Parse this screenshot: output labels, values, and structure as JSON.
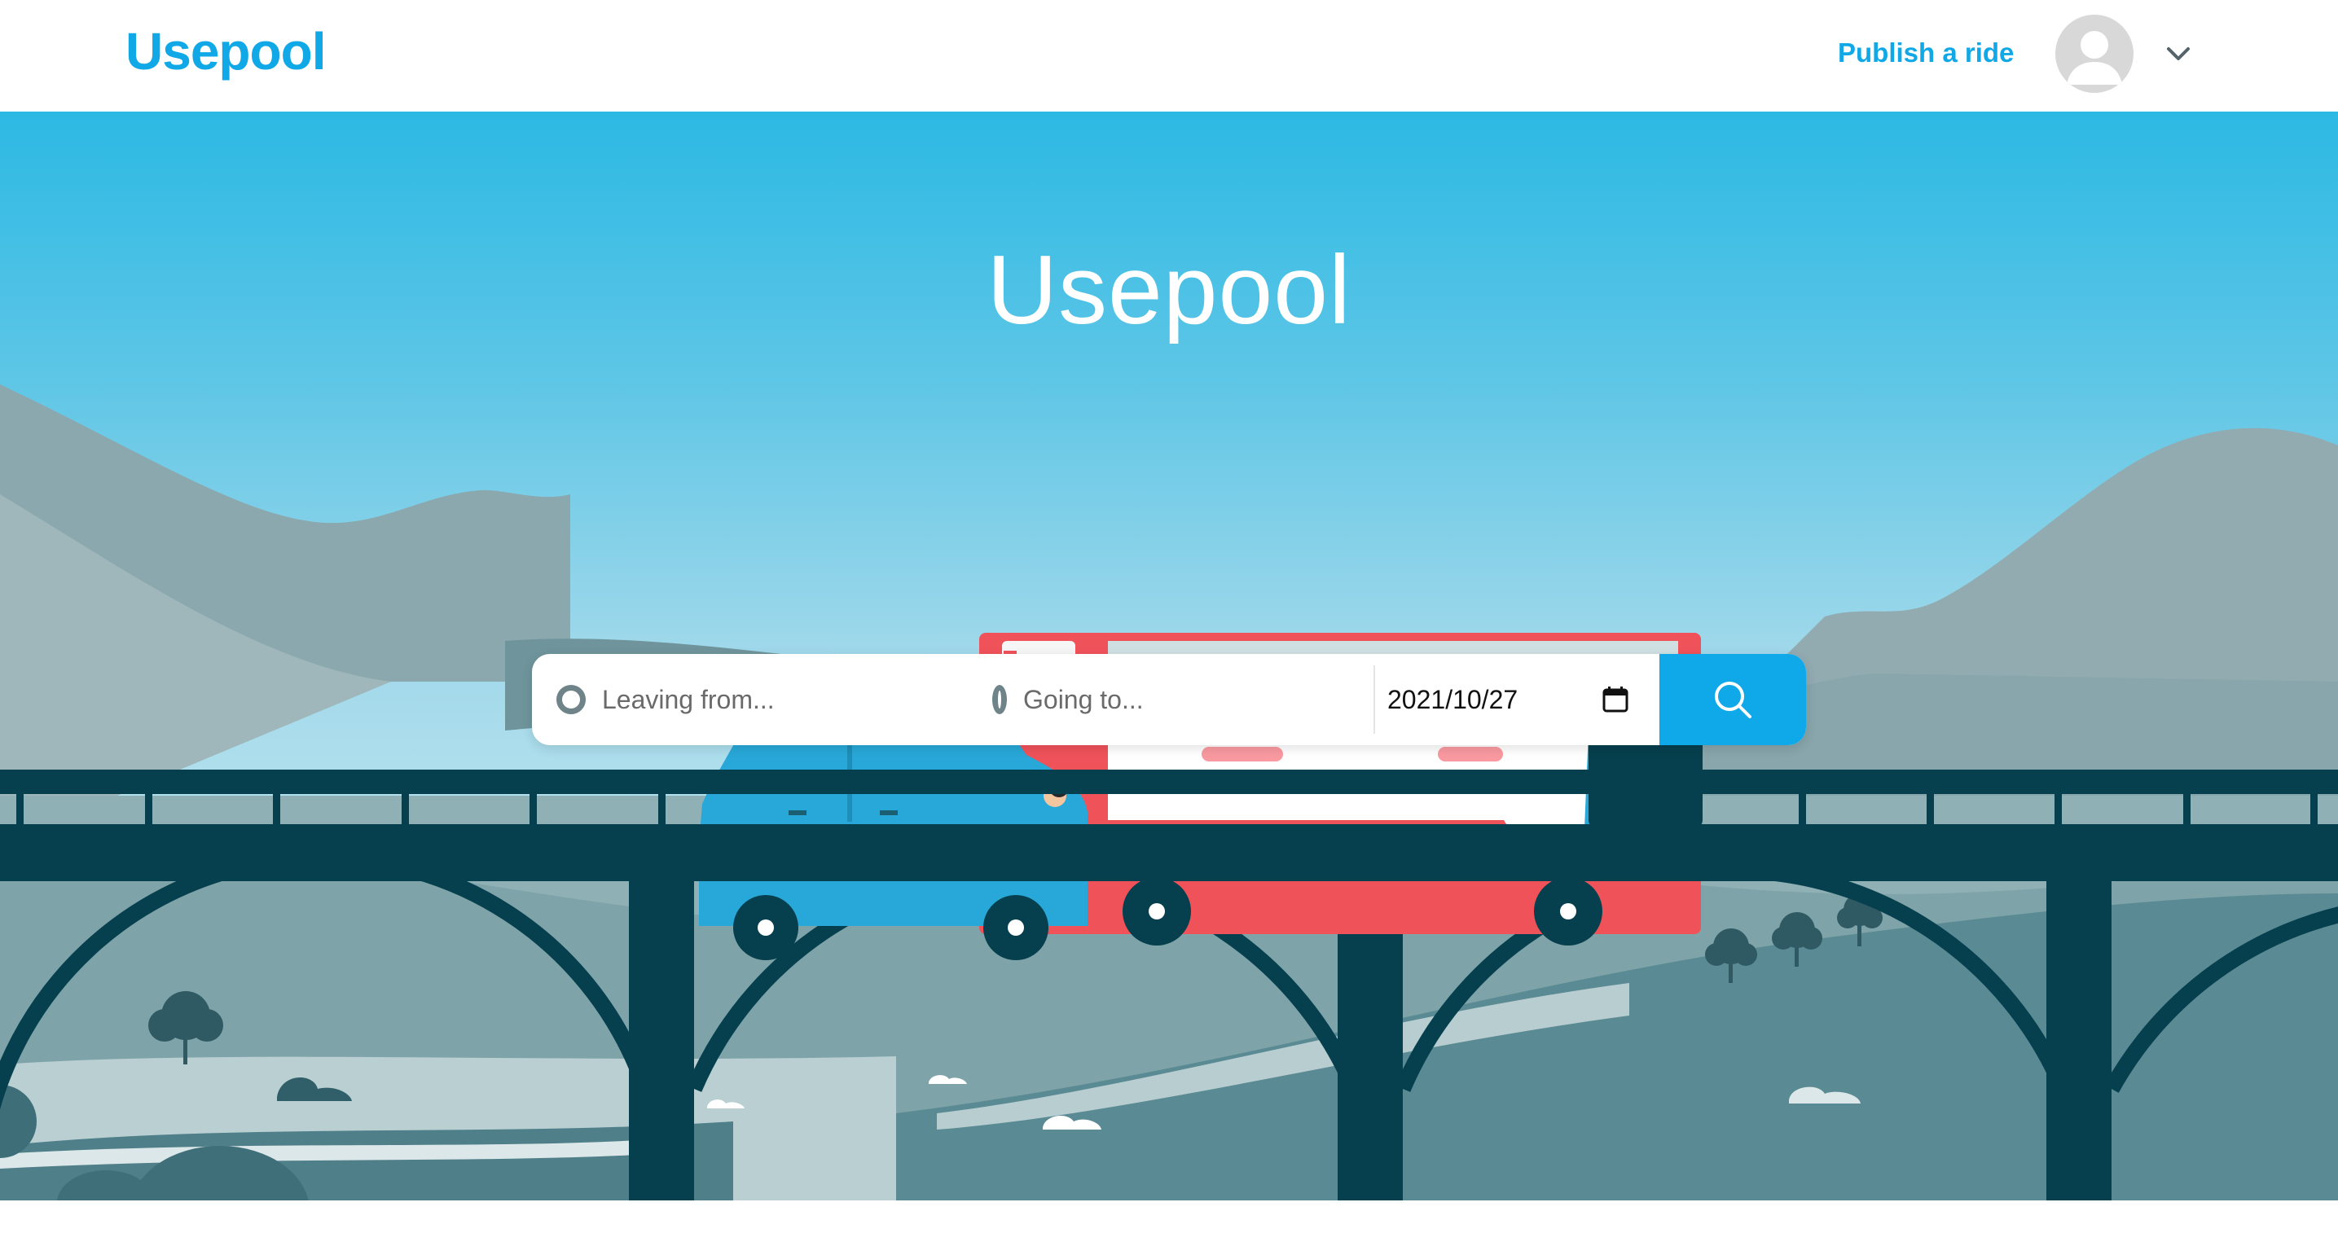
{
  "header": {
    "logo": "Usepool",
    "publish_label": "Publish a ride",
    "avatar_icon": "user-avatar-icon",
    "menu_icon": "chevron-down-icon"
  },
  "hero": {
    "title": "Usepool"
  },
  "search": {
    "from_placeholder": "Leaving from...",
    "to_placeholder": "Going to...",
    "date_value": "2021/10/27",
    "calendar_icon": "calendar-icon",
    "search_icon": "search-icon"
  },
  "colors": {
    "brand": "#10a8e6",
    "sky_top": "#2cb9e4",
    "bridge": "#06404e",
    "bus": "#f0525a",
    "car": "#28a8d8"
  }
}
